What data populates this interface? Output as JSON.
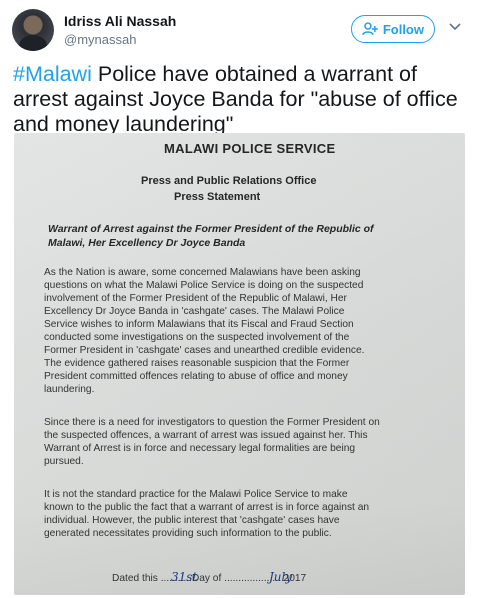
{
  "tweet": {
    "author_name": "Idriss Ali Nassah",
    "author_handle": "@mynassah",
    "follow_label": "Follow",
    "hashtag": "#Malawi",
    "text": " Police have obtained a warrant of arrest against Joyce Banda for \"abuse of office and money laundering\""
  },
  "document": {
    "header": "MALAWI POLICE SERVICE",
    "office": "Press and Public Relations Office",
    "statement": "Press Statement",
    "subject_lines": [
      "Warrant of Arrest against the Former President of the Republic of",
      "Malawi, Her Excellency Dr Joyce Banda"
    ],
    "paragraph_1": [
      "As the Nation is aware, some concerned Malawians have been asking",
      "questions on what the Malawi Police Service is doing on the suspected",
      "involvement of the Former President of the Republic of Malawi, Her",
      "Excellency Dr Joyce Banda in 'cashgate' cases.  The Malawi Police",
      "Service wishes to inform Malawians that its Fiscal and Fraud Section",
      "conducted some investigations on the suspected involvement of the",
      "Former President in 'cashgate' cases and unearthed credible evidence.",
      "The evidence gathered raises reasonable suspicion that the Former",
      "President committed offences relating to abuse of office and money",
      "laundering."
    ],
    "paragraph_2": [
      "Since there is a need for investigators to question the Former President on",
      "the suspected offences, a warrant of arrest was issued against her. This",
      "Warrant of Arrest is in force and necessary legal formalities are being",
      "pursued."
    ],
    "paragraph_3": [
      "It is not the standard practice for the Malawi Police Service to make",
      "known to the public the fact that a warrant of arrest is in force against an",
      "individual. However, the public interest that 'cashgate' cases have",
      "generated necessitates providing such information to the public."
    ],
    "dated_line": "Dated this ...........Day of .................... 2017",
    "handwritten_day": "31st",
    "handwritten_month": "July"
  }
}
